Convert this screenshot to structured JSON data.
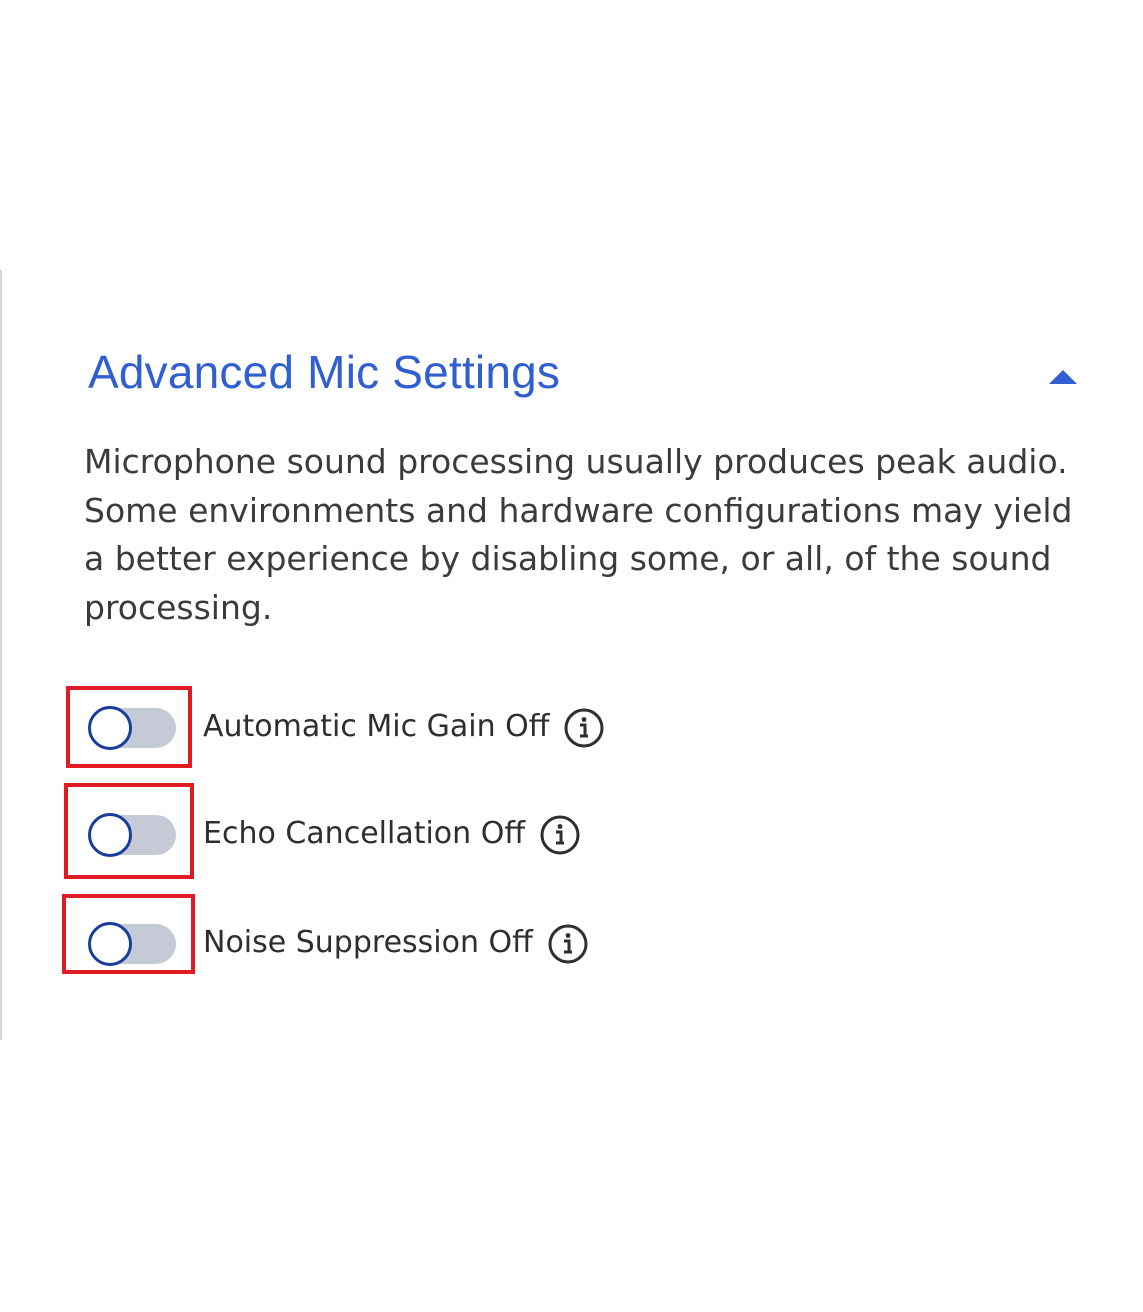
{
  "section": {
    "title": "Advanced Mic Settings",
    "collapse_icon": "caret-up-icon",
    "description": "Microphone sound processing usually produces peak audio. Some environments and hardware configurations may yield a better experience by disabling some, or all, of the sound processing."
  },
  "options": [
    {
      "label": "Automatic Mic Gain Off",
      "state": "off",
      "icon": "info-icon"
    },
    {
      "label": "Echo Cancellation Off",
      "state": "off",
      "icon": "info-icon"
    },
    {
      "label": "Noise Suppression Off",
      "state": "off",
      "icon": "info-icon"
    }
  ],
  "colors": {
    "title": "#2f5fd0",
    "highlight": "#e01b24",
    "toggle_track": "#c5cad6",
    "toggle_knob_border": "#1a3c9c",
    "text": "#3b3b3b"
  }
}
